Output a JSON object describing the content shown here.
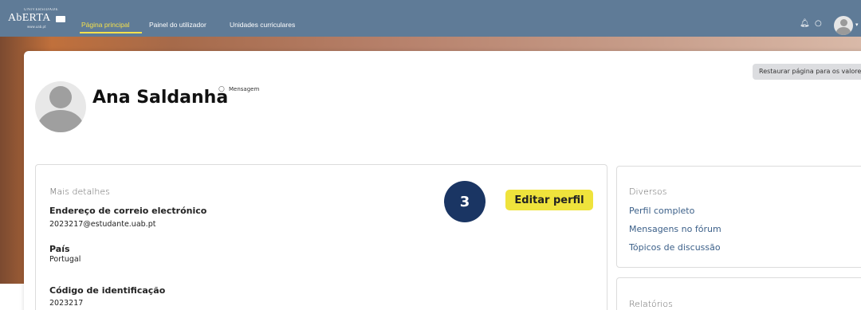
{
  "nav": {
    "logo_top": "UNIVERSIDADE",
    "logo_word": "AbERTA",
    "logo_url": "www.uab.pt",
    "links": [
      "Página principal",
      "Painel do utilizador",
      "Unidades curriculares"
    ],
    "active_index": 0
  },
  "header": {
    "restore_button": "Restaurar página para os valores",
    "user_name": "Ana Saldanha",
    "message_link": "Mensagem"
  },
  "details": {
    "section_title": "Mais detalhes",
    "step_number": "3",
    "edit_profile_button": "Editar perfil",
    "fields": [
      {
        "label": "Endereço de correio electrónico",
        "value": "2023217@estudante.uab.pt"
      },
      {
        "label": "País",
        "value": "Portugal"
      },
      {
        "label": "Código de identificação",
        "value": "2023217"
      }
    ]
  },
  "misc": {
    "section_title": "Diversos",
    "links": [
      "Perfil completo",
      "Mensagens no fórum",
      "Tópicos de discussão"
    ]
  },
  "reports": {
    "section_title": "Relatórios"
  },
  "colors": {
    "navbar": "#5f7b97",
    "accent_yellow": "#efe33c",
    "step_navy": "#1a3563",
    "link_blue": "#3c6089"
  },
  "icons": [
    "bell-icon",
    "chat-icon",
    "user-avatar",
    "chevron-down-icon",
    "message-icon"
  ]
}
